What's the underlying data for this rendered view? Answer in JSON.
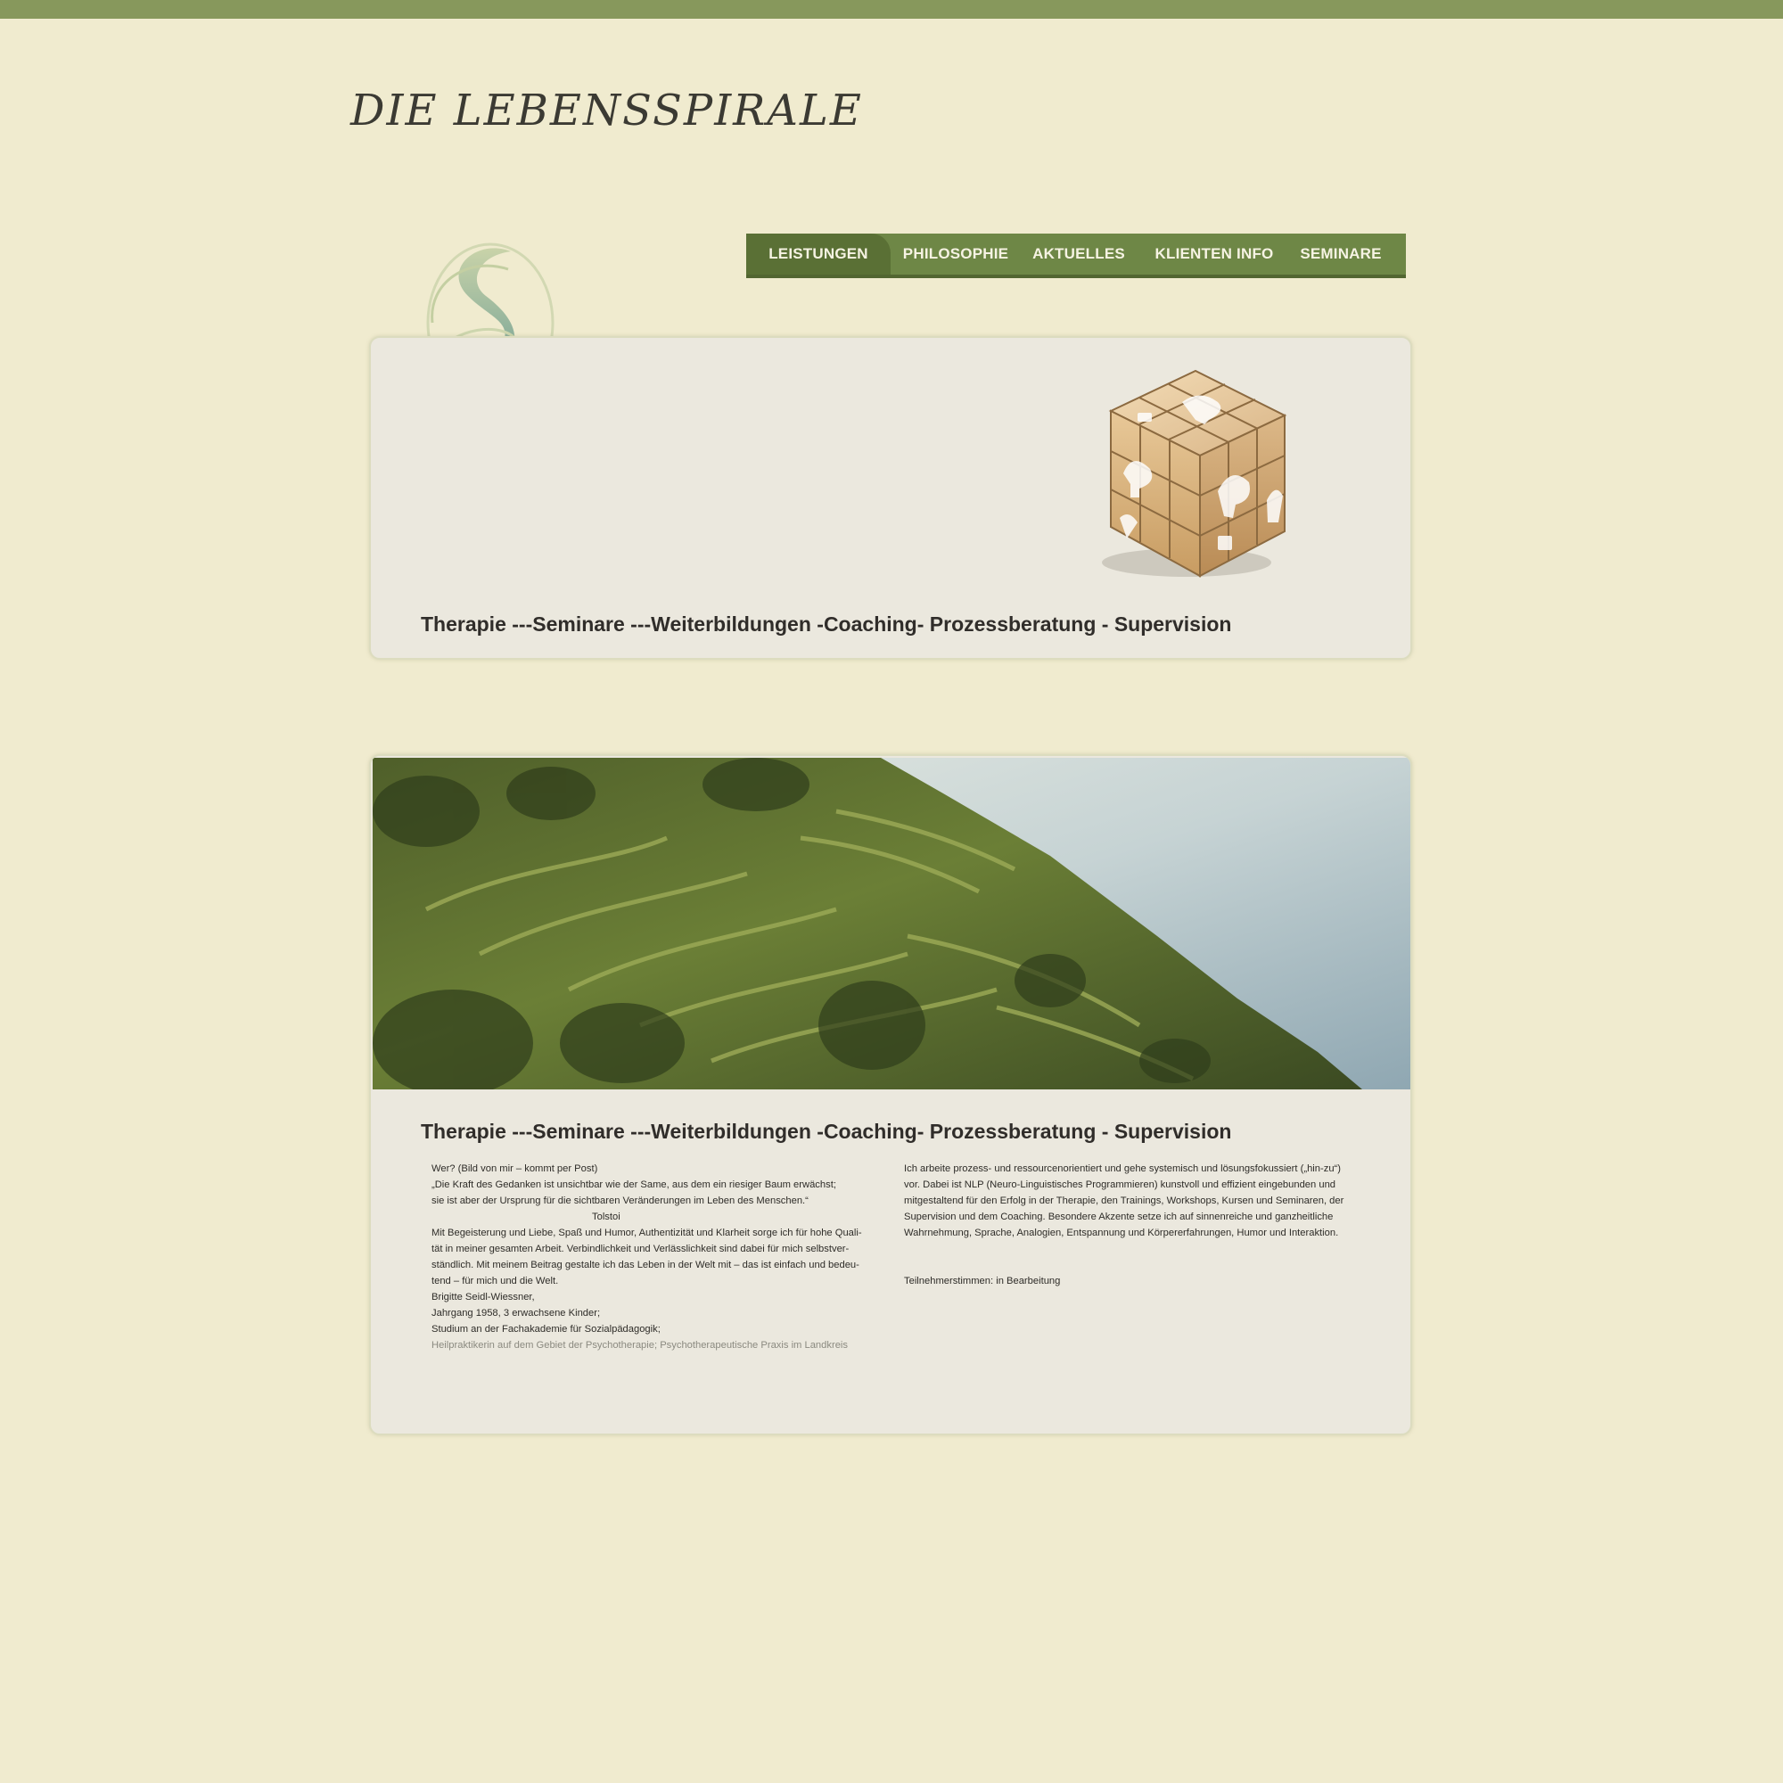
{
  "site": {
    "logo": "DIE LEBENSSPIRALE"
  },
  "nav": {
    "items": [
      {
        "label": "LEISTUNGEN",
        "active": true
      },
      {
        "label": "PHILOSOPHIE",
        "active": false
      },
      {
        "label": "AKTUELLES",
        "active": false
      },
      {
        "label": "KLIENTEN INFO",
        "active": false
      },
      {
        "label": "SEMINARE",
        "active": false
      }
    ]
  },
  "hero": {
    "tagline": "Therapie ---Seminare ---Weiterbildungen -Coaching- Prozessberatung - Supervision"
  },
  "main": {
    "tagline": "Therapie ---Seminare ---Weiterbildungen -Coaching- Prozessberatung - Supervision",
    "left_lines": [
      "Wer?   (Bild von mir – kommt per Post)",
      "„Die Kraft des Gedanken ist unsichtbar wie der Same, aus dem ein riesiger Baum erwächst;",
      "sie ist aber der Ursprung für die sichtbaren Veränderungen im Leben des Menschen.“",
      "Tolstoi",
      "Mit Begeisterung und Liebe,  Spaß und Humor, Authentizität und Klarheit  sorge ich für hohe Quali-",
      "tät in meiner  gesamten Arbeit. Verbindlichkeit und Verlässlichkeit sind dabei für mich selbstver-",
      "ständlich. Mit meinem Beitrag gestalte ich das Leben in der Welt mit – das ist einfach und bedeu-",
      "tend – für mich und die Welt.",
      "Brigitte Seidl-Wiessner,",
      "Jahrgang 1958, 3 erwachsene  Kinder;",
      "Studium an der Fachakademie für Sozialpädagogik;",
      "Heilpraktikerin auf dem Gebiet der Psychotherapie; Psychotherapeutische Praxis im Landkreis"
    ],
    "right_lines": [
      "Ich arbeite prozess- und ressourcenorientiert und gehe systemisch und lösungsfokussiert („hin-zu“)",
      "vor. Dabei ist NLP (Neuro-Linguistisches Programmieren) kunstvoll und effizient eingebunden und",
      "mitgestaltend für den Erfolg in der Therapie, den Trainings, Workshops, Kursen und Seminaren, der",
      "Supervision und dem Coaching. Besondere Akzente setze ich auf sinnenreiche und ganzheitliche",
      "Wahrnehmung, Sprache, Analogien, Entspannung und Körpererfahrungen, Humor und Interaktion."
    ],
    "testimonials": "Teilnehmerstimmen:  in Bearbeitung"
  },
  "colors": {
    "page_bg": "#f0ebcf",
    "topbar": "#87985c",
    "nav_bg": "#6e8746",
    "nav_active": "#5a7035",
    "text": "#302d2a"
  },
  "icons": {
    "logo_mark": "spiral-s-logo-icon",
    "hero_image": "question-mark-cube",
    "photo": "terraced-coast-landscape"
  }
}
